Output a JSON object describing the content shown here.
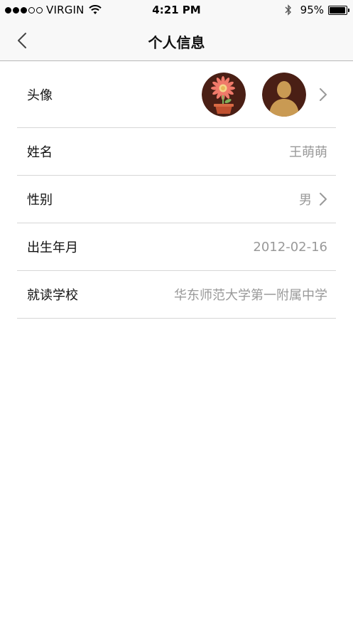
{
  "status_bar": {
    "carrier": "VIRGIN",
    "time": "4:21 PM",
    "battery_text": "95%",
    "battery_level": 0.95,
    "signal_bars_filled": 3,
    "signal_bars_total": 5
  },
  "nav": {
    "title": "个人信息"
  },
  "rows": [
    {
      "label": "头像"
    },
    {
      "label": "姓名",
      "value": "王萌萌"
    },
    {
      "label": "性别",
      "value": "男"
    },
    {
      "label": "出生年月",
      "value": "2012-02-16"
    },
    {
      "label": "就读学校",
      "value": "华东师范大学第一附属中学"
    }
  ],
  "icons": {
    "back": "chevron-left-icon",
    "disclosure": "chevron-right-icon",
    "wifi": "wifi-icon",
    "bluetooth": "bluetooth-icon"
  },
  "colors": {
    "value_text": "#999999",
    "divider": "#d6d6d6",
    "nav_bg": "#f8f8f8",
    "avatar_bg": "#4a1f15",
    "avatar_person": "#c99a53"
  }
}
